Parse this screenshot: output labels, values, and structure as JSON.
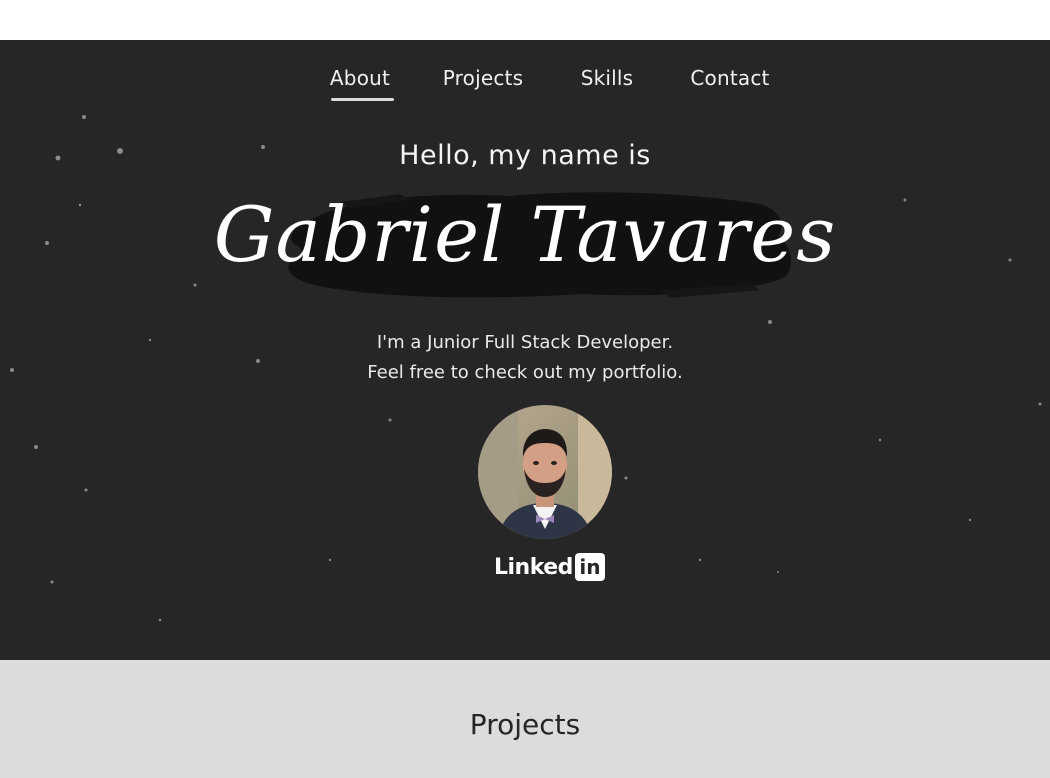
{
  "nav": {
    "items": [
      {
        "label": "About",
        "active": true
      },
      {
        "label": "Projects",
        "active": false
      },
      {
        "label": "Skills",
        "active": false
      },
      {
        "label": "Contact",
        "active": false
      }
    ]
  },
  "hero": {
    "greeting": "Hello, my name is",
    "name": "Gabriel Tavares",
    "intro_line1": "I'm a Junior Full Stack Developer.",
    "intro_line2": "Feel free to check out my portfolio.",
    "avatar_icon": "profile-photo",
    "linkedin": {
      "word": "Linked",
      "box": "in"
    }
  },
  "projects_section": {
    "title": "Projects"
  },
  "colors": {
    "hero_bg": "#262626",
    "section_bg": "#dcdcdc",
    "text_light": "#f0f0f0",
    "text_dark": "#262626"
  }
}
